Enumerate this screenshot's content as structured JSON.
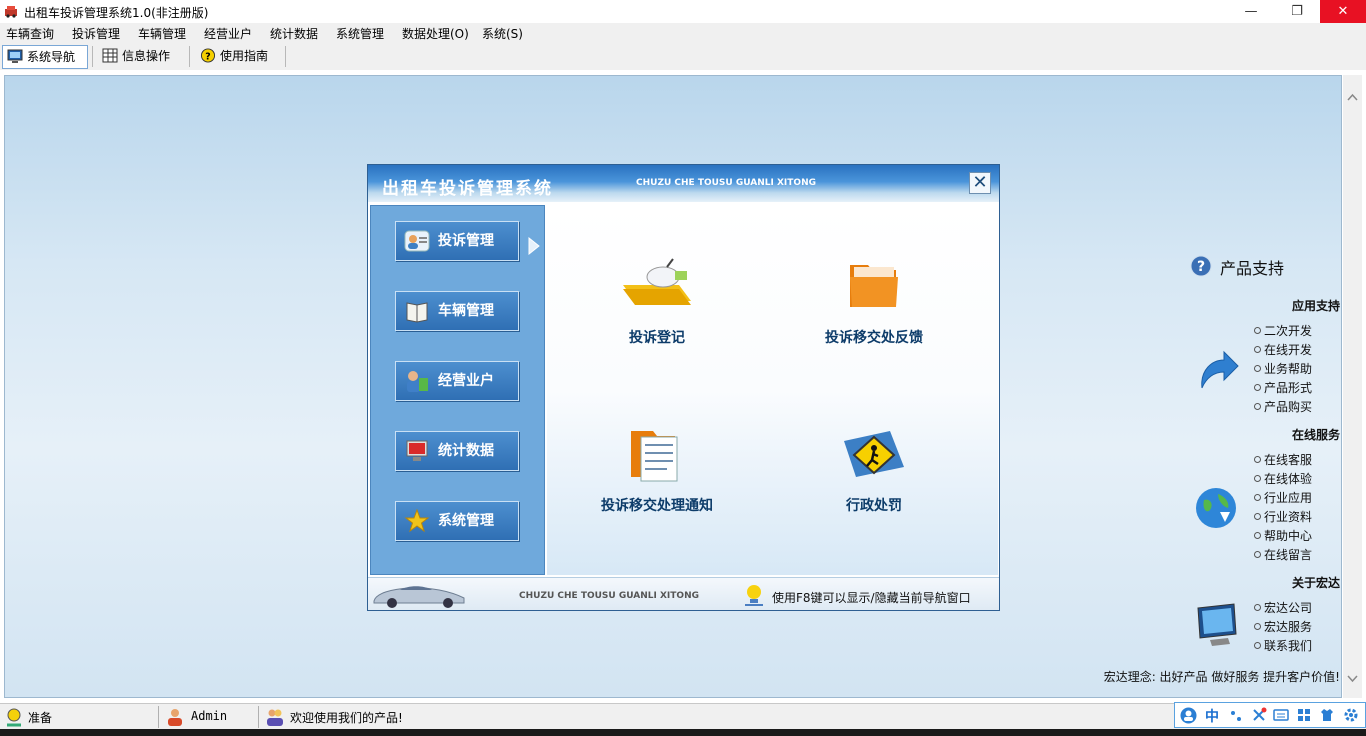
{
  "window": {
    "title": "出租车投诉管理系统1.0(非注册版)",
    "minimize": "—",
    "maximize": "❐",
    "close": "✕"
  },
  "menu": [
    "车辆查询",
    "投诉管理",
    "车辆管理",
    "经营业户",
    "统计数据",
    "系统管理",
    "数据处理(O)",
    "系统(S)"
  ],
  "toolbar": {
    "nav": "系统导航",
    "info": "信息操作",
    "guide": "使用指南"
  },
  "dialog": {
    "title": "出租车投诉管理系统",
    "subtitle": "CHUZU CHE TOUSU GUANLI XITONG",
    "close": "✕",
    "nav": [
      "投诉管理",
      "车辆管理",
      "经营业户",
      "统计数据",
      "系统管理"
    ],
    "items": [
      "投诉登记",
      "投诉移交处反馈",
      "投诉移交处理通知",
      "行政处罚"
    ],
    "footer_sub": "CHUZU CHE TOUSU GUANLI XITONG",
    "footer_tip": "使用F8键可以显示/隐藏当前导航窗口"
  },
  "support": {
    "title": "产品支持",
    "sections": [
      {
        "head": "应用支持",
        "links": [
          "二次开发",
          "在线开发",
          "业务帮助",
          "产品形式",
          "产品购买"
        ]
      },
      {
        "head": "在线服务",
        "links": [
          "在线客服",
          "在线体验",
          "行业应用",
          "行业资料",
          "帮助中心",
          "在线留言"
        ]
      },
      {
        "head": "关于宏达",
        "links": [
          "宏达公司",
          "宏达服务",
          "联系我们"
        ]
      }
    ],
    "motto": "宏达理念: 出好产品 做好服务 提升客户价值!"
  },
  "status": {
    "ready": "准备",
    "user": "Admin",
    "welcome": "欢迎使用我们的产品!"
  },
  "ime": {
    "lang": "中"
  }
}
